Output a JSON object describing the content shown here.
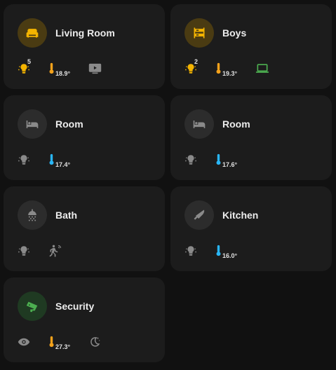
{
  "cards": [
    {
      "title": "Living Room",
      "count": "5",
      "temp": "18.9°"
    },
    {
      "title": "Boys",
      "count": "2",
      "temp": "19.3°"
    },
    {
      "title": "Room",
      "temp": "17.4°"
    },
    {
      "title": "Room",
      "temp": "17.6°"
    },
    {
      "title": "Bath"
    },
    {
      "title": "Kitchen",
      "temp": "16.0°"
    },
    {
      "title": "Security",
      "temp": "27.3°"
    }
  ],
  "colors": {
    "amber": "#f4b400",
    "green": "#4caf50",
    "thermo_warm": "#f4a21b",
    "thermo_cold": "#29b6f6",
    "muted": "#8a8a8a"
  },
  "icons": {
    "living_room": "sofa-icon",
    "boys": "bunk-bed-icon",
    "room": "bed-icon",
    "bath": "shower-icon",
    "kitchen": "knife-icon",
    "security": "cctv-icon",
    "lights": "lightbulb-group-icon",
    "thermometer": "thermometer-icon",
    "tv": "tv-icon",
    "laptop": "laptop-icon",
    "motion": "motion-sensor-icon",
    "eye": "eye-icon",
    "night": "moon-icon"
  }
}
